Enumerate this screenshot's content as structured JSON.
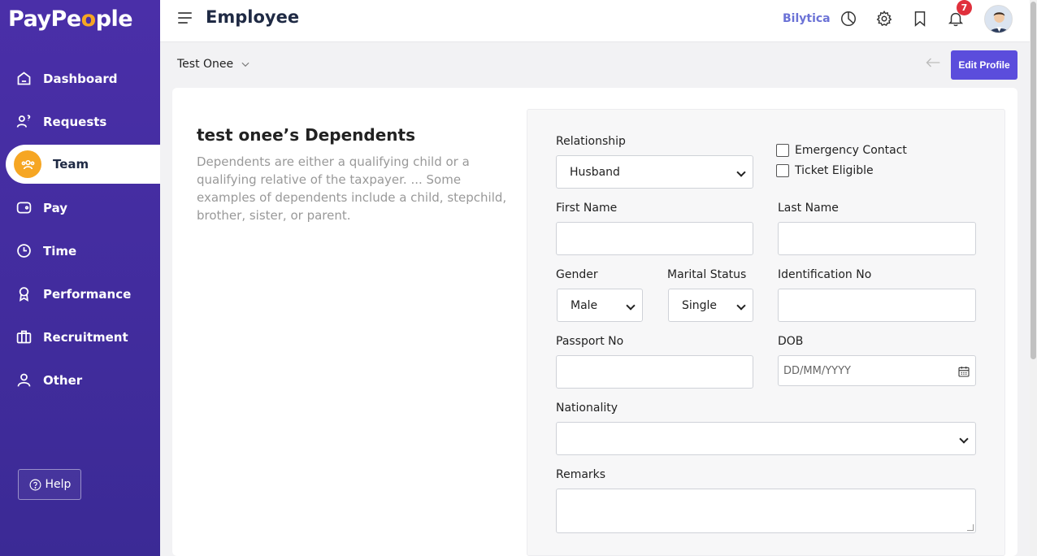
{
  "brand": {
    "logo_part1": "PayPe",
    "logo_o": "o",
    "logo_part2": "ple"
  },
  "sidebar": {
    "items": [
      {
        "label": "Dashboard"
      },
      {
        "label": "Requests"
      },
      {
        "label": "Team"
      },
      {
        "label": "Pay"
      },
      {
        "label": "Time"
      },
      {
        "label": "Performance"
      },
      {
        "label": "Recruitment"
      },
      {
        "label": "Other"
      }
    ],
    "active": "Team",
    "help_label": "Help"
  },
  "header": {
    "title": "Employee",
    "company": "Bilytica",
    "notification_count": "7"
  },
  "subbar": {
    "employee_name": "Test Onee",
    "edit_label": "Edit Profile"
  },
  "dependents": {
    "title": "test onee’s Dependents",
    "description": "Dependents are either a qualifying child or a qualifying relative of the taxpayer. ... Some examples of dependents include a child, stepchild, brother, sister, or parent."
  },
  "form": {
    "relationship_label": "Relationship",
    "relationship_value": "Husband",
    "emergency_contact_label": "Emergency Contact",
    "ticket_eligible_label": "Ticket Eligible",
    "first_name_label": "First Name",
    "first_name_value": "",
    "last_name_label": "Last Name",
    "last_name_value": "",
    "gender_label": "Gender",
    "gender_value": "Male",
    "marital_status_label": "Marital Status",
    "marital_status_value": "Single",
    "identification_label": "Identification No",
    "identification_value": "",
    "passport_label": "Passport No",
    "passport_value": "",
    "dob_label": "DOB",
    "dob_placeholder": "DD/MM/YYYY",
    "nationality_label": "Nationality",
    "nationality_value": "",
    "remarks_label": "Remarks",
    "remarks_value": ""
  },
  "colors": {
    "sidebar": "#4a2fa8",
    "accent": "#5b4ddc",
    "active_icon": "#f6a623",
    "badge": "#e0303c",
    "company": "#6b72d6"
  }
}
